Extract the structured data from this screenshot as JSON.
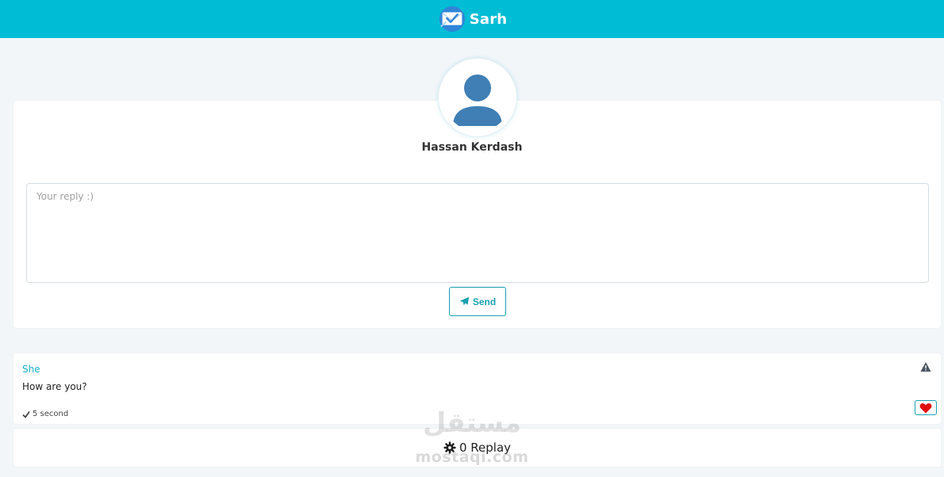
{
  "header": {
    "brand_name": "Sarh",
    "logo_icon": "envelope-check-icon",
    "background_color": "#00bcd4"
  },
  "profile": {
    "name": "Hassan Kerdash",
    "avatar_icon": "user-silhouette-icon"
  },
  "reply_form": {
    "placeholder": "Your reply :)",
    "value": "",
    "send_label": "Send",
    "send_icon": "paper-plane-icon"
  },
  "message": {
    "author": "She",
    "text": "How are you?",
    "time": "5 second",
    "time_icon": "check-icon",
    "report_icon": "warning-triangle-icon",
    "like_icon": "heart-icon",
    "liked": true
  },
  "replies": {
    "label": "0 Replay",
    "icon": "gear-icon"
  },
  "watermark": {
    "arabic": "مستقل",
    "latin": "mostaqi.com"
  },
  "colors": {
    "accent": "#00bcd4",
    "button_border": "#1aa0b0",
    "author": "#1ab0c8",
    "heart": "#e01010",
    "avatar": "#3f7fb5"
  }
}
